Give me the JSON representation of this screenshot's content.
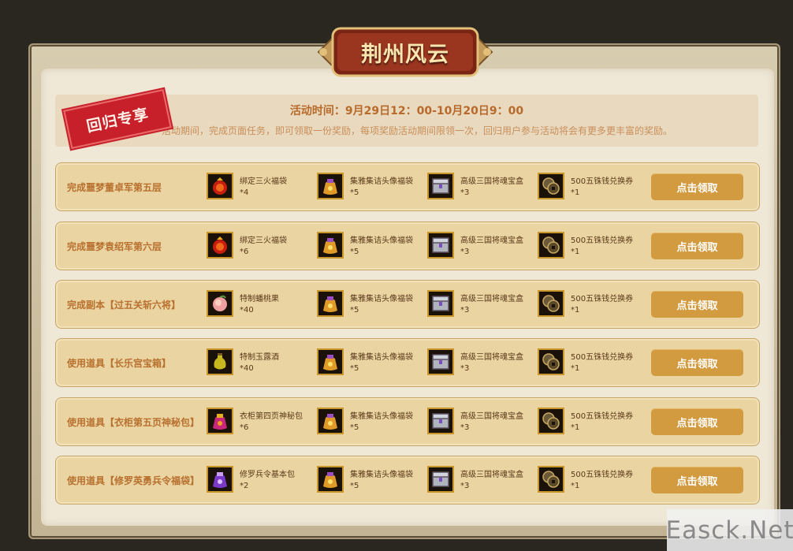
{
  "header": {
    "title": "荆州风云"
  },
  "info": {
    "time": "活动时间：9月29日12：00-10月20日9：00",
    "desc": "活动期间，完成页面任务，即可领取一份奖励，每项奖励活动期间限领一次，回归用户参与活动将会有更多更丰富的奖励。",
    "stamp": "回归专享"
  },
  "tasks": [
    {
      "title": "完成噩梦董卓军第五层",
      "rewards": [
        {
          "name": "绑定三火福袋",
          "count": "*4",
          "icon": "red-fire-bag-icon"
        },
        {
          "name": "集雅集诘头像福袋",
          "count": "*5",
          "icon": "gold-bag-icon"
        },
        {
          "name": "高级三国将魂宝盒",
          "count": "*3",
          "icon": "treasure-chest-icon"
        },
        {
          "name": "500五铢钱兑换券",
          "count": "*1",
          "icon": "coin-coupon-icon"
        }
      ],
      "button": "点击领取"
    },
    {
      "title": "完成噩梦袁绍军第六层",
      "rewards": [
        {
          "name": "绑定三火福袋",
          "count": "*6",
          "icon": "red-fire-bag-icon"
        },
        {
          "name": "集雅集诘头像福袋",
          "count": "*5",
          "icon": "gold-bag-icon"
        },
        {
          "name": "高级三国将魂宝盒",
          "count": "*3",
          "icon": "treasure-chest-icon"
        },
        {
          "name": "500五铢钱兑换券",
          "count": "*1",
          "icon": "coin-coupon-icon"
        }
      ],
      "button": "点击领取"
    },
    {
      "title": "完成副本【过五关斩六将】",
      "rewards": [
        {
          "name": "特制蟠桃果",
          "count": "*40",
          "icon": "peach-icon"
        },
        {
          "name": "集雅集诘头像福袋",
          "count": "*5",
          "icon": "gold-bag-icon"
        },
        {
          "name": "高级三国将魂宝盒",
          "count": "*3",
          "icon": "treasure-chest-icon"
        },
        {
          "name": "500五铢钱兑换券",
          "count": "*1",
          "icon": "coin-coupon-icon"
        }
      ],
      "button": "点击领取"
    },
    {
      "title": "使用道具【长乐宫宝箱】",
      "rewards": [
        {
          "name": "特制玉露酒",
          "count": "*40",
          "icon": "wine-jug-icon"
        },
        {
          "name": "集雅集诘头像福袋",
          "count": "*5",
          "icon": "gold-bag-icon"
        },
        {
          "name": "高级三国将魂宝盒",
          "count": "*3",
          "icon": "treasure-chest-icon"
        },
        {
          "name": "500五铢钱兑换券",
          "count": "*1",
          "icon": "coin-coupon-icon"
        }
      ],
      "button": "点击领取"
    },
    {
      "title": "使用道具【衣柜第五页神秘包】",
      "rewards": [
        {
          "name": "衣柜第四页神秘包",
          "count": "*6",
          "icon": "mystery-bag-icon"
        },
        {
          "name": "集雅集诘头像福袋",
          "count": "*5",
          "icon": "gold-bag-icon"
        },
        {
          "name": "高级三国将魂宝盒",
          "count": "*3",
          "icon": "treasure-chest-icon"
        },
        {
          "name": "500五铢钱兑换券",
          "count": "*1",
          "icon": "coin-coupon-icon"
        }
      ],
      "button": "点击领取"
    },
    {
      "title": "使用道具【修罗英勇兵令福袋】",
      "rewards": [
        {
          "name": "修罗兵令基本包",
          "count": "*2",
          "icon": "purple-bag-icon"
        },
        {
          "name": "集雅集诘头像福袋",
          "count": "*5",
          "icon": "gold-bag-icon"
        },
        {
          "name": "高级三国将魂宝盒",
          "count": "*3",
          "icon": "treasure-chest-icon"
        },
        {
          "name": "500五铢钱兑换券",
          "count": "*1",
          "icon": "coin-coupon-icon"
        }
      ],
      "button": "点击领取"
    }
  ],
  "watermark": "Easck.Net"
}
